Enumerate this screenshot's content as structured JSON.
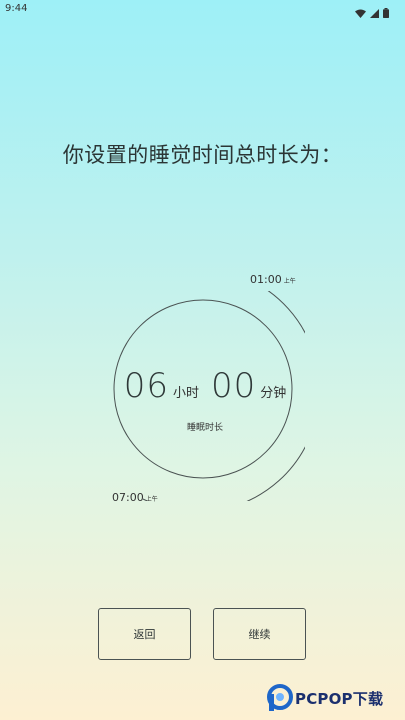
{
  "status_bar": {
    "time": "9:44"
  },
  "title": "你设置的睡觉时间总时长为：",
  "dial": {
    "wake_time": "01:00",
    "wake_ampm": "上午",
    "bed_time": "07:00",
    "bed_ampm": "上午",
    "hours": "06",
    "hours_unit": "小时",
    "minutes": "00",
    "minutes_unit": "分钟",
    "label": "睡眠时长"
  },
  "buttons": {
    "back": "返回",
    "continue": "继续"
  },
  "watermark": {
    "text": "PCPOP下载"
  }
}
